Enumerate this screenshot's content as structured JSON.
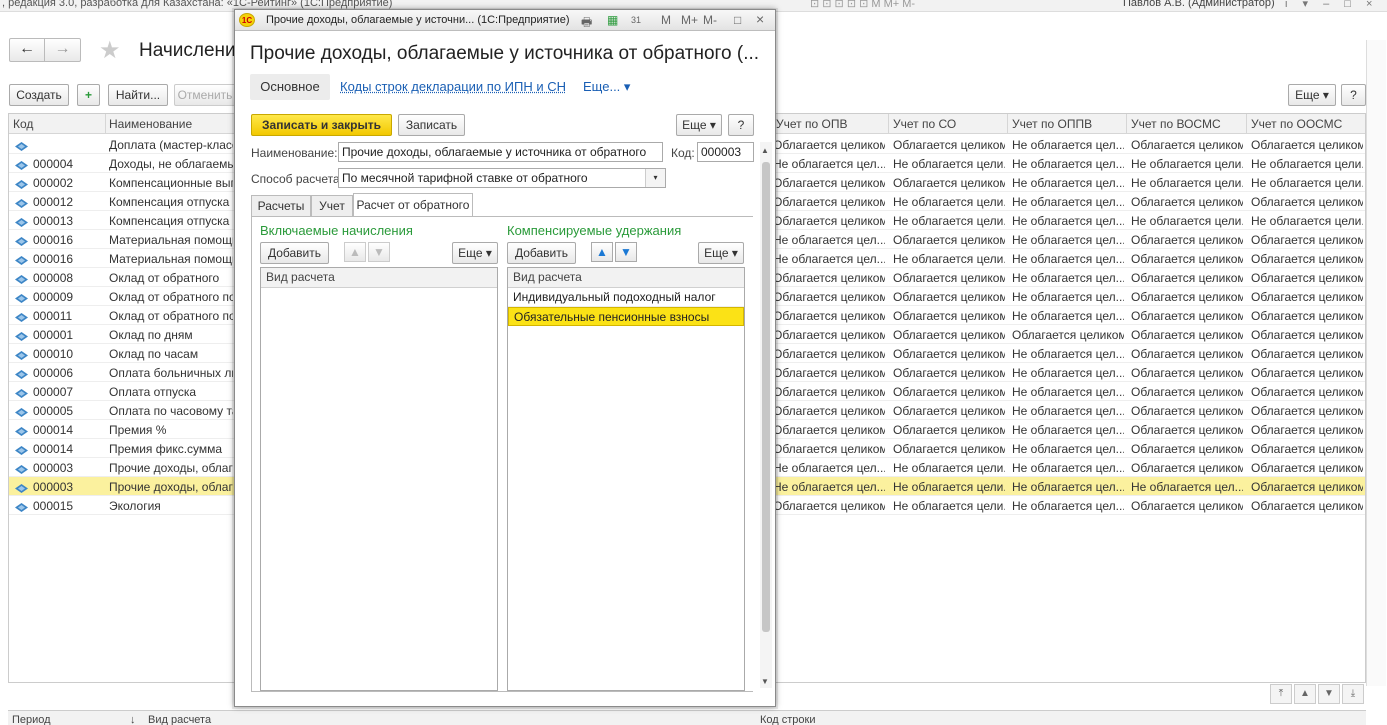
{
  "app": {
    "title_fragment": ", редакция 3.0, разработка для Казахстана: «1С-Рейтинг» (1С:Предприятие)",
    "user": "Павлов А.В. (Администратор)",
    "tool_icons": "⊡ ⊡ ⊡ ⊡ ⊡ M M+ M-",
    "right_icons": "i ▾ – □ ×"
  },
  "background": {
    "page_title": "Начислени",
    "back_icon": "←",
    "forward_icon": "→",
    "favorite_icon": "★",
    "close_icon": "×",
    "toolbar": {
      "create": "Создать",
      "find": "Найти...",
      "cancel": "Отменить",
      "more": "Еще ▾",
      "help": "?"
    },
    "columns": [
      "Код",
      "Наименование",
      "Учет по ОПВ",
      "Учет по СО",
      "Учет по ОППВ",
      "Учет по ВОСМС",
      "Учет по ООСМС"
    ],
    "rows": [
      {
        "code": "",
        "name": "Доплата (мастер-класс",
        "opv": "Облагается целиком",
        "so": "Облагается целиком",
        "oppv": "Не облагается цел...",
        "vosms": "Облагается целиком",
        "oosms": "Облагается целиком"
      },
      {
        "code": "000004",
        "name": "Доходы, не облагаемые",
        "opv": "Не облагается цел...",
        "so": "Не облагается цели...",
        "oppv": "Не облагается цел...",
        "vosms": "Не облагается цели...",
        "oosms": "Не облагается цели..."
      },
      {
        "code": "000002",
        "name": "Компенсационные выпл",
        "opv": "Облагается целиком",
        "so": "Облагается целиком",
        "oppv": "Не облагается цел...",
        "vosms": "Не облагается цели...",
        "oosms": "Не облагается цели..."
      },
      {
        "code": "000012",
        "name": "Компенсация отпуска",
        "opv": "Облагается целиком",
        "so": "Не облагается цели...",
        "oppv": "Не облагается цел...",
        "vosms": "Облагается целиком",
        "oosms": "Облагается целиком"
      },
      {
        "code": "000013",
        "name": "Компенсация отпуска пр",
        "opv": "Облагается целиком",
        "so": "Не облагается цели...",
        "oppv": "Не облагается цел...",
        "vosms": "Не облагается цели...",
        "oosms": "Не облагается цели..."
      },
      {
        "code": "000016",
        "name": "Материальная помощь",
        "opv": "Не облагается цел...",
        "so": "Облагается целиком",
        "oppv": "Не облагается цел...",
        "vosms": "Облагается целиком",
        "oosms": "Облагается целиком"
      },
      {
        "code": "000016",
        "name": "Материальная помощь",
        "opv": "Не облагается цел...",
        "so": "Не облагается цели...",
        "oppv": "Не облагается цел...",
        "vosms": "Облагается целиком",
        "oosms": "Облагается целиком"
      },
      {
        "code": "000008",
        "name": "Оклад от обратного",
        "opv": "Облагается целиком",
        "so": "Облагается целиком",
        "oppv": "Не облагается цел...",
        "vosms": "Облагается целиком",
        "oosms": "Облагается целиком"
      },
      {
        "code": "000009",
        "name": "Оклад от обратного по д",
        "opv": "Облагается целиком",
        "so": "Облагается целиком",
        "oppv": "Не облагается цел...",
        "vosms": "Облагается целиком",
        "oosms": "Облагается целиком"
      },
      {
        "code": "000011",
        "name": "Оклад от обратного по ч",
        "opv": "Облагается целиком",
        "so": "Облагается целиком",
        "oppv": "Не облагается цел...",
        "vosms": "Облагается целиком",
        "oosms": "Облагается целиком"
      },
      {
        "code": "000001",
        "name": "Оклад по дням",
        "opv": "Облагается целиком",
        "so": "Облагается целиком",
        "oppv": "Облагается целиком",
        "vosms": "Облагается целиком",
        "oosms": "Облагается целиком"
      },
      {
        "code": "000010",
        "name": "Оклад по часам",
        "opv": "Облагается целиком",
        "so": "Облагается целиком",
        "oppv": "Не облагается цел...",
        "vosms": "Облагается целиком",
        "oosms": "Облагается целиком"
      },
      {
        "code": "000006",
        "name": "Оплата больничных лист",
        "opv": "Облагается целиком",
        "so": "Облагается целиком",
        "oppv": "Не облагается цел...",
        "vosms": "Облагается целиком",
        "oosms": "Облагается целиком"
      },
      {
        "code": "000007",
        "name": "Оплата отпуска",
        "opv": "Облагается целиком",
        "so": "Облагается целиком",
        "oppv": "Не облагается цел...",
        "vosms": "Облагается целиком",
        "oosms": "Облагается целиком"
      },
      {
        "code": "000005",
        "name": "Оплата по часовому тар",
        "opv": "Облагается целиком",
        "so": "Облагается целиком",
        "oppv": "Не облагается цел...",
        "vosms": "Облагается целиком",
        "oosms": "Облагается целиком"
      },
      {
        "code": "000014",
        "name": "Премия %",
        "opv": "Облагается целиком",
        "so": "Облагается целиком",
        "oppv": "Не облагается цел...",
        "vosms": "Облагается целиком",
        "oosms": "Облагается целиком"
      },
      {
        "code": "000014",
        "name": "Премия фикс.сумма",
        "opv": "Облагается целиком",
        "so": "Облагается целиком",
        "oppv": "Не облагается цел...",
        "vosms": "Облагается целиком",
        "oosms": "Облагается целиком"
      },
      {
        "code": "000003",
        "name": "Прочие доходы, облагае",
        "opv": "Не облагается цел...",
        "so": "Не облагается цели...",
        "oppv": "Не облагается цел...",
        "vosms": "Облагается целиком",
        "oosms": "Облагается целиком"
      },
      {
        "code": "000003",
        "name": "Прочие доходы, облагае",
        "opv": "Не облагается цел...",
        "so": "Не облагается цели...",
        "oppv": "Не облагается цел...",
        "vosms": "Не облагается цел...",
        "oosms": "Облагается целиком",
        "selected": true
      },
      {
        "code": "000015",
        "name": "Экология",
        "opv": "Облагается целиком",
        "so": "Не облагается цели...",
        "oppv": "Не облагается цел...",
        "vosms": "Облагается целиком",
        "oosms": "Облагается целиком"
      }
    ],
    "bottom_columns": [
      "Период",
      "Вид расчета",
      "Код строки"
    ],
    "sort_icon": "↓"
  },
  "modal": {
    "titlebar": "Прочие доходы, облагаемые у источни... (1С:Предприятие)",
    "logo_text": "1С",
    "titlebar_icons": [
      "🖶",
      "▦",
      "31",
      "M",
      "M+",
      "M-",
      "□",
      "×"
    ],
    "heading": "Прочие доходы, облагаемые у источника от обратного (...",
    "nav_main": "Основное",
    "nav_link": "Коды строк декларации по ИПН и СН",
    "nav_more": "Еще... ▾",
    "save_close": "Записать и закрыть",
    "save": "Записать",
    "more": "Еще ▾",
    "help": "?",
    "name_label": "Наименование:",
    "name_value": "Прочие доходы, облагаемые у источника от обратного",
    "code_label": "Код:",
    "code_value": "000003",
    "method_label": "Способ расчета:",
    "method_value": "По месячной тарифной ставке от обратного",
    "dropdown_icon": "▾",
    "tabs": [
      "Расчеты",
      "Учет",
      "Расчет от обратного"
    ],
    "included": {
      "title": "Включаемые начисления",
      "add": "Добавить",
      "more": "Еще ▾",
      "up_icon": "▲",
      "down_icon": "▼",
      "column": "Вид расчета",
      "rows": []
    },
    "compensated": {
      "title": "Компенсируемые удержания",
      "add": "Добавить",
      "more": "Еще ▾",
      "up_icon": "▲",
      "down_icon": "▼",
      "column": "Вид расчета",
      "rows": [
        "Индивидуальный подоходный налог",
        "Обязательные пенсионные взносы"
      ],
      "selected_index": 1
    },
    "scroll_up": "▲",
    "scroll_down": "▼"
  },
  "colors": {
    "selection": "#fbe216",
    "accent_yellow": "#f2c800",
    "link": "#1a5fb4",
    "section_green": "#2a9a3a"
  }
}
